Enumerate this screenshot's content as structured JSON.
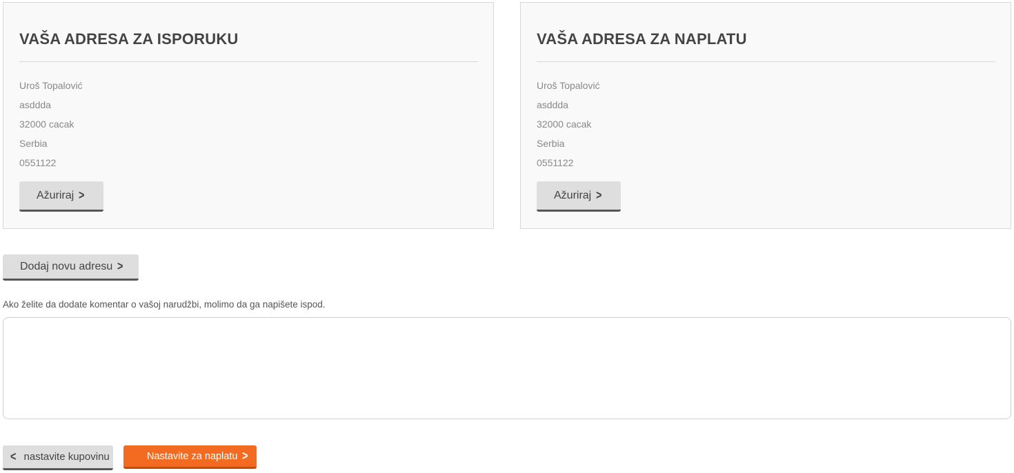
{
  "delivery": {
    "title": "VAŠA ADRESA ZA ISPORUKU",
    "lines": [
      "Uroš Topalović",
      "asddda",
      "32000 cacak",
      "Serbia",
      "0551122"
    ],
    "update_label": "Ažuriraj"
  },
  "billing": {
    "title": "VAŠA ADRESA ZA NAPLATU",
    "lines": [
      "Uroš Topalović",
      "asddda",
      "32000 cacak",
      "Serbia",
      "0551122"
    ],
    "update_label": "Ažuriraj"
  },
  "add_address_label": "Dodaj novu adresu",
  "comment": {
    "label": "Ako želite da dodate komentar o vašoj narudžbi, molimo da ga napišete ispod.",
    "value": "",
    "placeholder": ""
  },
  "footer": {
    "back_label": "nastavite kupovinu",
    "continue_label": "Nastavite za naplatu"
  },
  "colors": {
    "accent": "#f26b21",
    "button_gray": "#dedede",
    "panel_bg": "#f9f9f9"
  },
  "icons": {
    "chevron_right": "chevron-right-icon",
    "chevron_left": "chevron-left-icon"
  }
}
